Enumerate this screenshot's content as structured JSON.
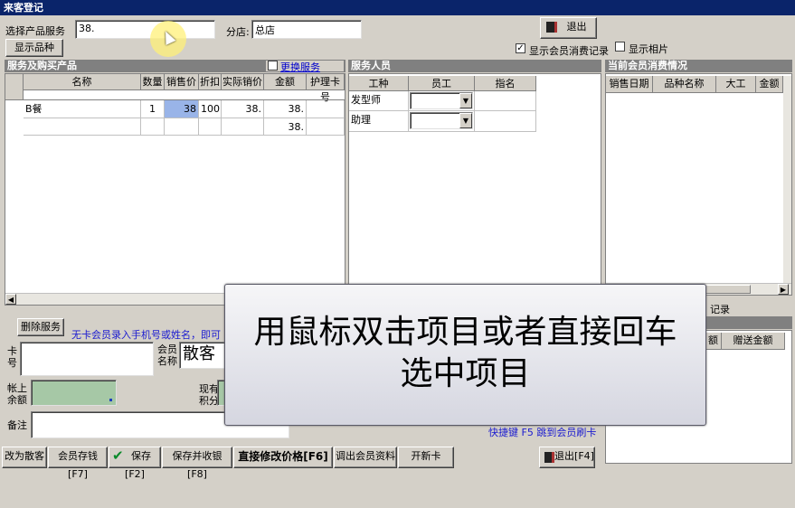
{
  "window": {
    "title": "来客登记"
  },
  "top": {
    "select_service_label": "选择产品服务",
    "select_service_value": "38.",
    "branch_label": "分店:",
    "branch_value": "总店",
    "exit_label": "退出",
    "show_variety_label": "显示品种",
    "show_member_consumption_label": "显示会员消费记录",
    "show_member_consumption_checked": "✓",
    "show_photo_label": "显示相片"
  },
  "services_panel": {
    "title": "服务及购买产品",
    "change_service_label": "更换服务",
    "columns": [
      "名称",
      "数量",
      "销售价",
      "折扣",
      "实际销价",
      "金额",
      "护理卡号"
    ],
    "rows": [
      [
        "B餐",
        "1",
        "38",
        "100",
        "38.",
        "38.",
        ""
      ],
      [
        "",
        "",
        "",
        "",
        "",
        "38.",
        ""
      ]
    ]
  },
  "staff_panel": {
    "title": "服务人员",
    "columns": [
      "工种",
      "员工",
      "指名"
    ],
    "rows": [
      [
        "发型师",
        "",
        ""
      ],
      [
        "助理",
        "",
        ""
      ]
    ]
  },
  "member_panel": {
    "title": "当前会员消费情况",
    "columns": [
      "销售日期",
      "品种名称",
      "大工",
      "金额"
    ],
    "records_tab_label": "记录",
    "columns2": [
      "额",
      "赠送金额"
    ]
  },
  "bottom": {
    "delete_service_label": "删除服务",
    "hint": "无卡会员录入手机号或姓名，即可",
    "card_no_label": "卡号",
    "member_name_label": "会员名称",
    "member_name_value": "散客",
    "account_balance_label": "帐上余额",
    "points_label": "现有积分",
    "remark_label": "备注",
    "shortcut_hint": "快捷键 F5 跳到会员刷卡"
  },
  "buttons": {
    "to_walkin": "改为散客",
    "member_deposit": "会员存钱[F7]",
    "save": "保存[F2]",
    "save_checkout": "保存并收银[F8]",
    "edit_price": "直接修改价格[F6]",
    "load_member": "调出会员资料",
    "new_card": "开新卡",
    "exit_f4": "退出[F4]"
  },
  "overlay": {
    "line1": "用鼠标双击项目或者直接回车",
    "line2": "选中项目"
  }
}
